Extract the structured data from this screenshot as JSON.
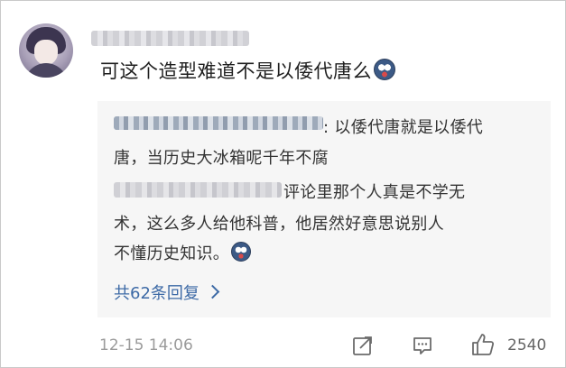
{
  "comment": {
    "text": "可这个造型难道不是以倭代唐么"
  },
  "reply": {
    "line1_suffix": ": 以倭代唐就是以倭代",
    "line2": "唐，当历史大冰箱呢千年不腐",
    "line3_suffix": "评论里那个人真是不学无",
    "line4": "术，这么多人给他科普，他居然好意思说别人",
    "line5": "不懂历史知识。",
    "more_label": "共62条回复"
  },
  "footer": {
    "timestamp": "12-15 14:06",
    "like_count": "2540",
    "icons": [
      "share-icon",
      "comment-icon",
      "thumbs-up-icon"
    ]
  }
}
